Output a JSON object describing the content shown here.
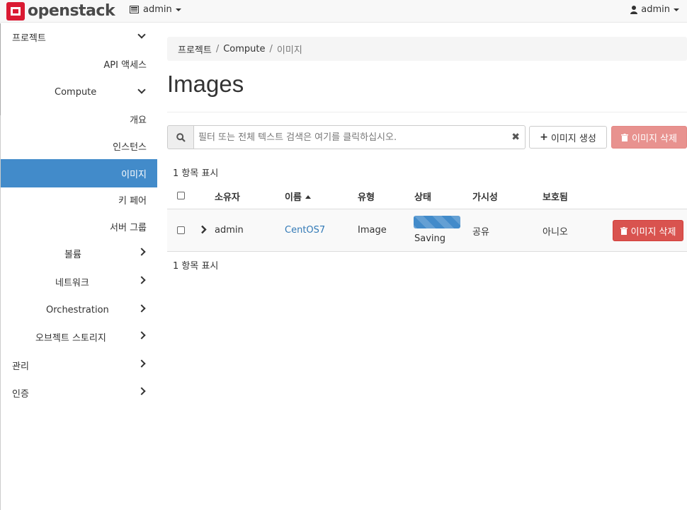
{
  "navbar": {
    "logo_text": "openstack",
    "project_label": "admin",
    "user_label": "admin"
  },
  "sidebar": {
    "items": [
      {
        "label": "프로젝트",
        "icon": "chevron-down-icon"
      },
      {
        "label": "API 액세스"
      },
      {
        "label": "Compute",
        "icon": "chevron-down-icon"
      },
      {
        "label": "개요"
      },
      {
        "label": "인스턴스"
      },
      {
        "label": "이미지",
        "active": true
      },
      {
        "label": "키 페어"
      },
      {
        "label": "서버 그룹"
      },
      {
        "label": "볼륨",
        "icon": "chevron-right-icon"
      },
      {
        "label": "네트워크",
        "icon": "chevron-right-icon"
      },
      {
        "label": "Orchestration",
        "icon": "chevron-right-icon"
      },
      {
        "label": "오브젝트 스토리지",
        "icon": "chevron-right-icon"
      },
      {
        "label": "관리",
        "icon": "chevron-right-icon"
      },
      {
        "label": "인증",
        "icon": "chevron-right-icon"
      }
    ]
  },
  "breadcrumb": [
    "프로젝트",
    "Compute",
    "이미지"
  ],
  "page_title": "Images",
  "search": {
    "placeholder": "필터 또는 전체 텍스트 검색은 여기를 클릭하십시오."
  },
  "actions": {
    "create_label": "이미지 생성",
    "delete_label": "이미지 삭제"
  },
  "count_text": "1 항목 표시",
  "table": {
    "headers": [
      "소유자",
      "이름",
      "유형",
      "상태",
      "가시성",
      "보호됨"
    ],
    "rows": [
      {
        "owner": "admin",
        "name": "CentOS7",
        "type": "Image",
        "status": "Saving",
        "visibility": "공유",
        "protected": "아니오",
        "action_label": "이미지 삭제"
      }
    ]
  },
  "colors": {
    "active": "#428bca",
    "danger": "#d9534f",
    "brand": "#da1a32",
    "link": "#337ab7"
  }
}
